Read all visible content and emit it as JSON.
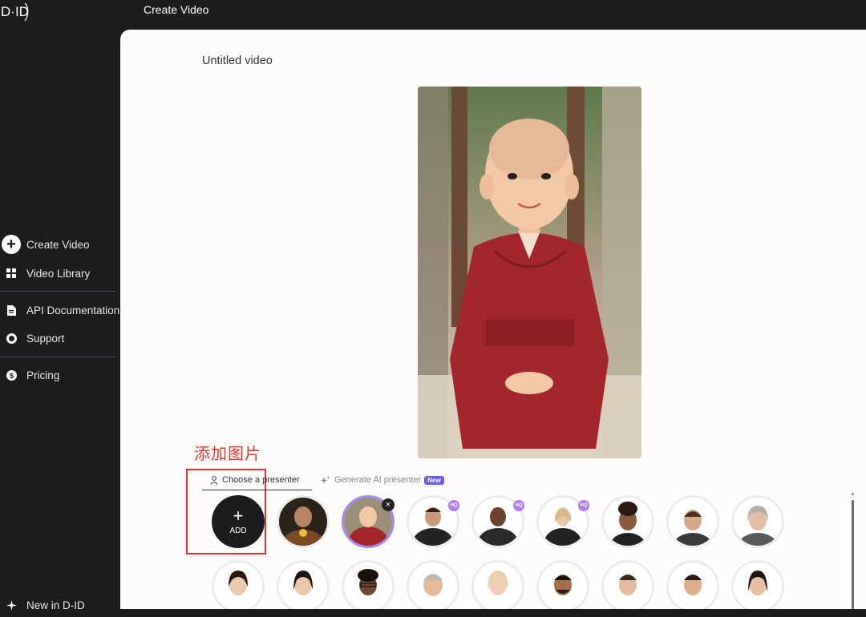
{
  "header": {
    "logo_text": "D·ID",
    "title": "Create Video"
  },
  "sidebar": {
    "items": [
      {
        "label": "Create Video",
        "icon": "plus-circle-icon"
      },
      {
        "label": "Video Library",
        "icon": "grid-icon"
      },
      {
        "label": "API Documentation",
        "icon": "document-icon"
      },
      {
        "label": "Support",
        "icon": "lifebuoy-icon"
      },
      {
        "label": "Pricing",
        "icon": "dollar-icon"
      },
      {
        "label": "New in D-ID",
        "icon": "sparkle-icon"
      }
    ]
  },
  "main": {
    "video_title": "Untitled video",
    "annotation_text": "添加图片",
    "tabs": [
      {
        "label": "Choose a presenter",
        "active": true
      },
      {
        "label": "Generate AI presenter",
        "badge": "New",
        "active": false
      }
    ],
    "add_button_label": "ADD",
    "hq_badge": "HQ",
    "remove_symbol": "×",
    "presenter_count": 17
  },
  "colors": {
    "accent": "#6a5cf0",
    "annotation": "#e8322b",
    "sidebar_bg": "#1b1c1e",
    "hq_badge": "#b07af0"
  }
}
